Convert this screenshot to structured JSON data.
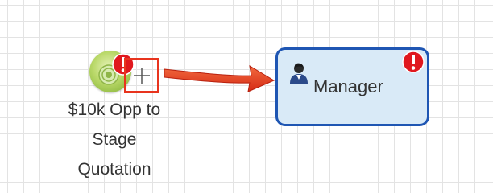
{
  "canvas": {
    "start_event": {
      "label_lines": [
        "$10k Opp to",
        "Stage",
        "Quotation"
      ],
      "has_error": true
    },
    "task": {
      "label": "Manager",
      "has_error": true
    },
    "connector_icon": "plus-icon",
    "colors": {
      "task_border": "#1f56b3",
      "task_fill": "#d9eaf7",
      "error_red": "#e0181e",
      "highlight_red": "#e8341e",
      "start_green": "#93bd45"
    }
  }
}
